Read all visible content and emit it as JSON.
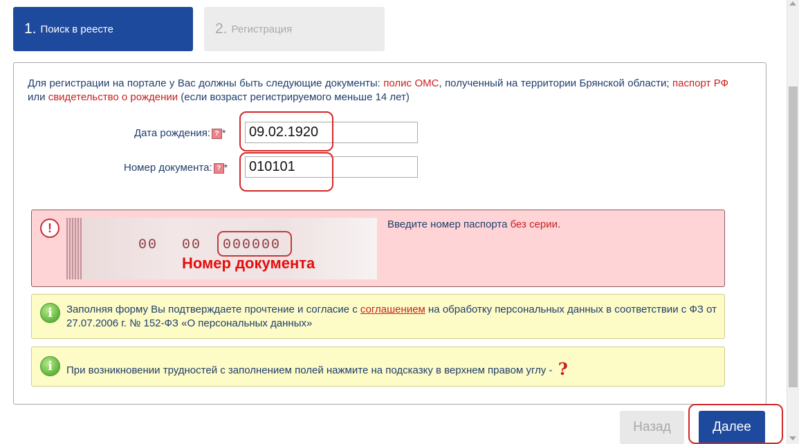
{
  "steps": [
    {
      "number": "1.",
      "label": "Поиск в реесте"
    },
    {
      "number": "2.",
      "label": "Регистрация"
    }
  ],
  "intro": {
    "t1": "Для регистрации на портале у Вас должны быть следующие документы: ",
    "oms": "полис ОМС",
    "t2": ", полученный на территории Брянской области; ",
    "passport": "паспорт РФ",
    "t3": " или ",
    "birth_cert": "свидетельство о рождении",
    "t4": " (если возраст регистрируемого меньше 14 лет)"
  },
  "form": {
    "birth_date": {
      "label": "Дата рождения:",
      "help": "?",
      "required": "*",
      "value": "09.02.1920"
    },
    "doc_number": {
      "label": "Номер документа:",
      "help": "?",
      "required": "*",
      "value": "010101"
    }
  },
  "error": {
    "icon": "exclamation-icon",
    "icon_glyph": "!",
    "passport_series_1": "00",
    "passport_series_2": "00",
    "passport_number": "000000",
    "passport_caption": "Номер документа",
    "text_1": "Введите номер паспорта ",
    "text_highlight": "без серии",
    "text_2": "."
  },
  "info1": {
    "icon": "info-icon",
    "icon_glyph": "i",
    "text_1": "Заполняя форму Вы подтверждаете прочтение и согласие с ",
    "link": "соглашением",
    "text_2": " на обработку персональных данных в соответствии с ФЗ от 27.07.2006 г. № 152-ФЗ «О персональных данных»"
  },
  "info2": {
    "icon": "info-icon",
    "icon_glyph": "i",
    "text": "При возникновении трудностей с заполнением полей нажмите на подсказку в верхнем правом углу - ",
    "question": "?"
  },
  "buttons": {
    "back": "Назад",
    "next": "Далее"
  },
  "colors": {
    "primary": "#1e4a9d",
    "highlight_red": "#d42626",
    "error_bg": "#ffd4d6",
    "info_bg": "#fdfbc6"
  }
}
